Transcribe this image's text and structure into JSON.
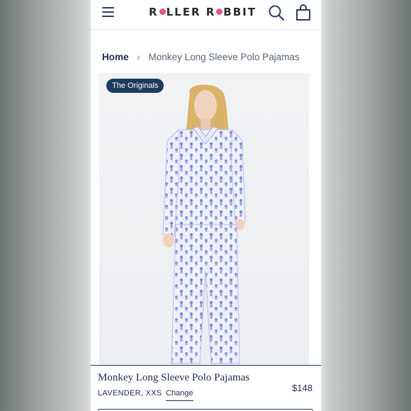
{
  "header": {
    "logo_text_a": "R",
    "logo_text_b": "LLER R",
    "logo_text_c": "BBIT",
    "logo_full": "ROLLER RABBIT"
  },
  "breadcrumb": {
    "home": "Home",
    "separator": "›",
    "current": "Monkey Long Sleeve Polo Pajamas"
  },
  "product_image": {
    "badge": "The Originals"
  },
  "product": {
    "name": "Monkey Long Sleeve Polo Pajamas",
    "variant": "LAVENDER, XXS",
    "change_label": "Change",
    "price": "$148"
  },
  "colors": {
    "navy": "#1e3a5f",
    "accent_pink": "#e25a7d",
    "pajama_lavender": "#c9cdf0"
  },
  "icons": [
    "menu-icon",
    "search-icon",
    "shopping-bag-icon",
    "chevron-right-icon"
  ]
}
